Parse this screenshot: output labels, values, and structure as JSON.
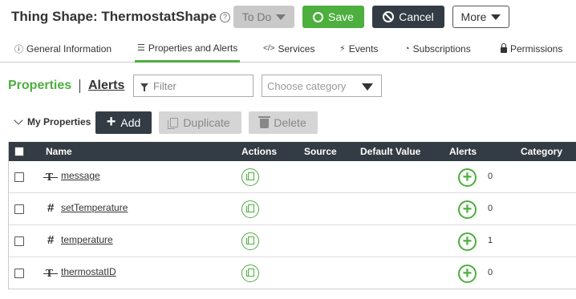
{
  "header": {
    "title_prefix": "Thing Shape:",
    "title_name": "ThermostatShape",
    "help_glyph": "?",
    "todo_label": "To Do",
    "save_label": "Save",
    "cancel_label": "Cancel",
    "more_label": "More"
  },
  "tabs": [
    {
      "label": "General Information",
      "icon": "info-icon",
      "glyph": "ⓘ",
      "active": false
    },
    {
      "label": "Properties and Alerts",
      "icon": "list-icon",
      "glyph": "☰",
      "active": true
    },
    {
      "label": "Services",
      "icon": "code-icon",
      "glyph": "</>",
      "active": false
    },
    {
      "label": "Events",
      "icon": "lightning-icon",
      "glyph": "⚡",
      "active": false
    },
    {
      "label": "Subscriptions",
      "icon": "rss-icon",
      "glyph": "◔",
      "active": false
    },
    {
      "label": "Permissions",
      "icon": "lock-icon",
      "glyph": "🔒",
      "active": false
    }
  ],
  "subheader": {
    "properties_label": "Properties",
    "alerts_label": "Alerts",
    "filter_placeholder": "Filter",
    "category_placeholder": "Choose category"
  },
  "toolbar": {
    "section_label": "My Properties",
    "add_label": "Add",
    "duplicate_label": "Duplicate",
    "delete_label": "Delete"
  },
  "table": {
    "columns": [
      "Name",
      "Actions",
      "Source",
      "Default Value",
      "Alerts",
      "Category"
    ],
    "rows": [
      {
        "type": "string",
        "type_glyph": "T",
        "name": "message",
        "source": "",
        "default_value": "",
        "alerts": "0",
        "category": ""
      },
      {
        "type": "number",
        "type_glyph": "#",
        "name": "setTemperature",
        "source": "",
        "default_value": "",
        "alerts": "0",
        "category": ""
      },
      {
        "type": "number",
        "type_glyph": "#",
        "name": "temperature",
        "source": "",
        "default_value": "",
        "alerts": "1",
        "category": ""
      },
      {
        "type": "string",
        "type_glyph": "T",
        "name": "thermostatID",
        "source": "",
        "default_value": "",
        "alerts": "0",
        "category": ""
      }
    ]
  },
  "colors": {
    "accent_green": "#4caf3e",
    "dark": "#333c44",
    "disabled_gray": "#d5d5d5"
  }
}
